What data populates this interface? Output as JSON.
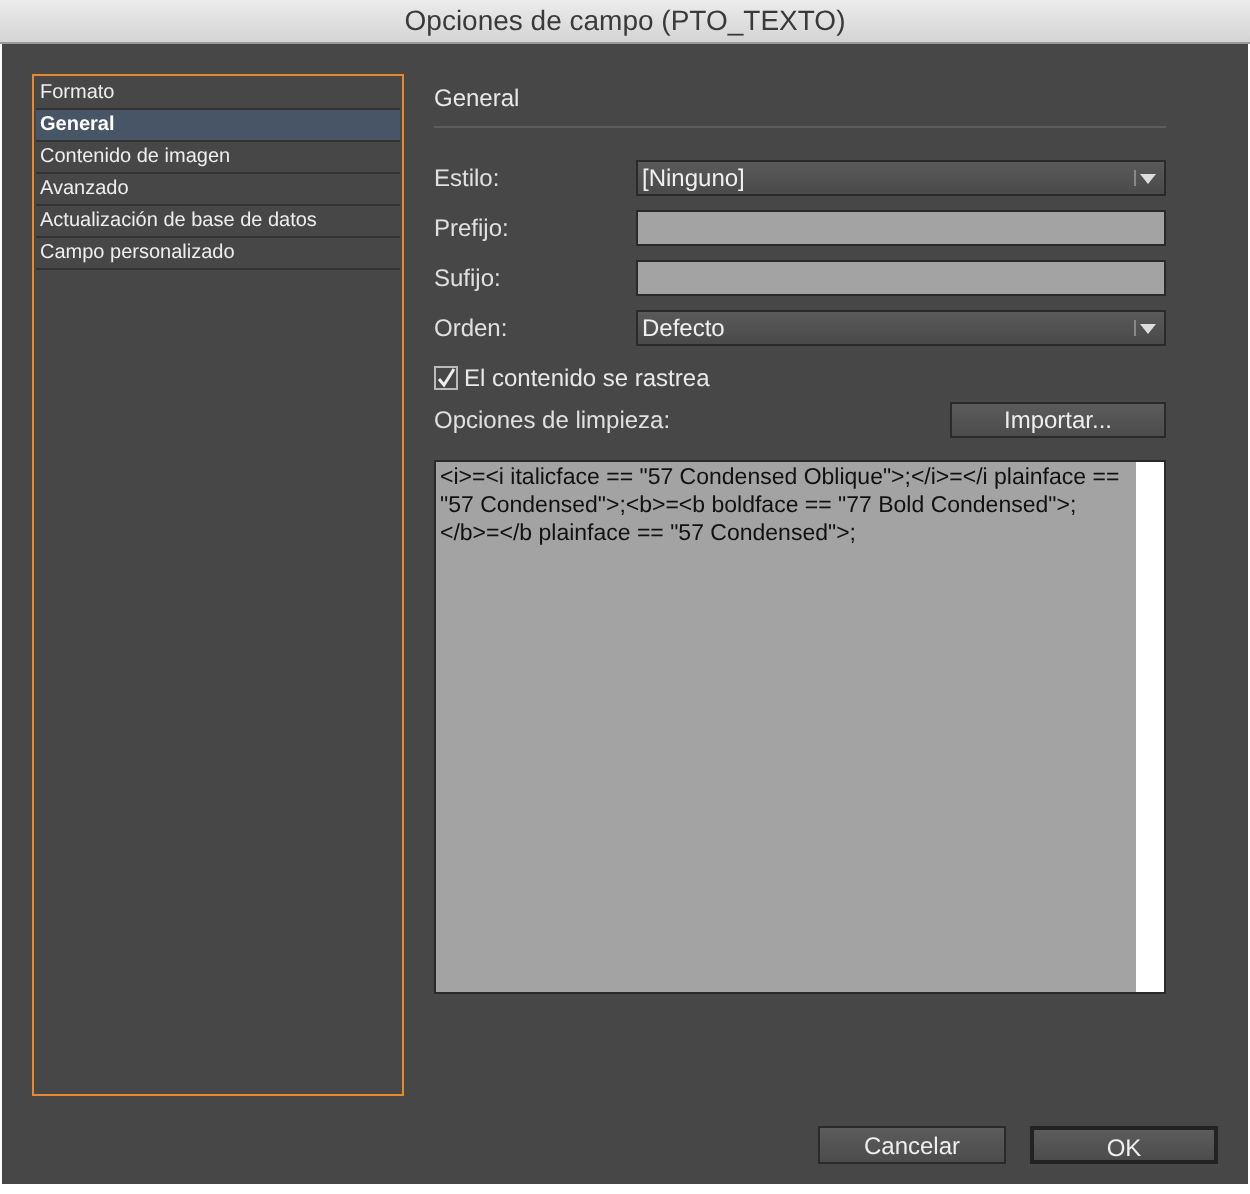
{
  "window": {
    "title": "Opciones de campo (PTO_TEXTO)"
  },
  "sidebar": {
    "items": [
      {
        "label": "Formato",
        "selected": false
      },
      {
        "label": "General",
        "selected": true
      },
      {
        "label": "Contenido de imagen",
        "selected": false
      },
      {
        "label": "Avanzado",
        "selected": false
      },
      {
        "label": "Actualización de base de datos",
        "selected": false
      },
      {
        "label": "Campo personalizado",
        "selected": false
      }
    ]
  },
  "section": {
    "title": "General"
  },
  "fields": [
    {
      "kind": "dropdown",
      "label": "Estilo:",
      "value": "[Ninguno]"
    },
    {
      "kind": "text",
      "label": "Prefijo:"
    },
    {
      "kind": "text",
      "label": "Sufijo:"
    },
    {
      "kind": "dropdown",
      "label": "Orden:",
      "value": "Defecto"
    }
  ],
  "tracking": {
    "label": "El contenido se rastrea",
    "checked": true
  },
  "cleanup": {
    "label": "Opciones de limpieza:",
    "import_button": "Importar...",
    "text": "<i>=<i italicface == \"57 Condensed Oblique\">;</i>=</i plainface == \"57 Condensed\">;<b>=<b boldface == \"77 Bold Condensed\">;</b>=</b plainface == \"57 Condensed\">;"
  },
  "buttons": [
    "Cancelar",
    "OK"
  ]
}
